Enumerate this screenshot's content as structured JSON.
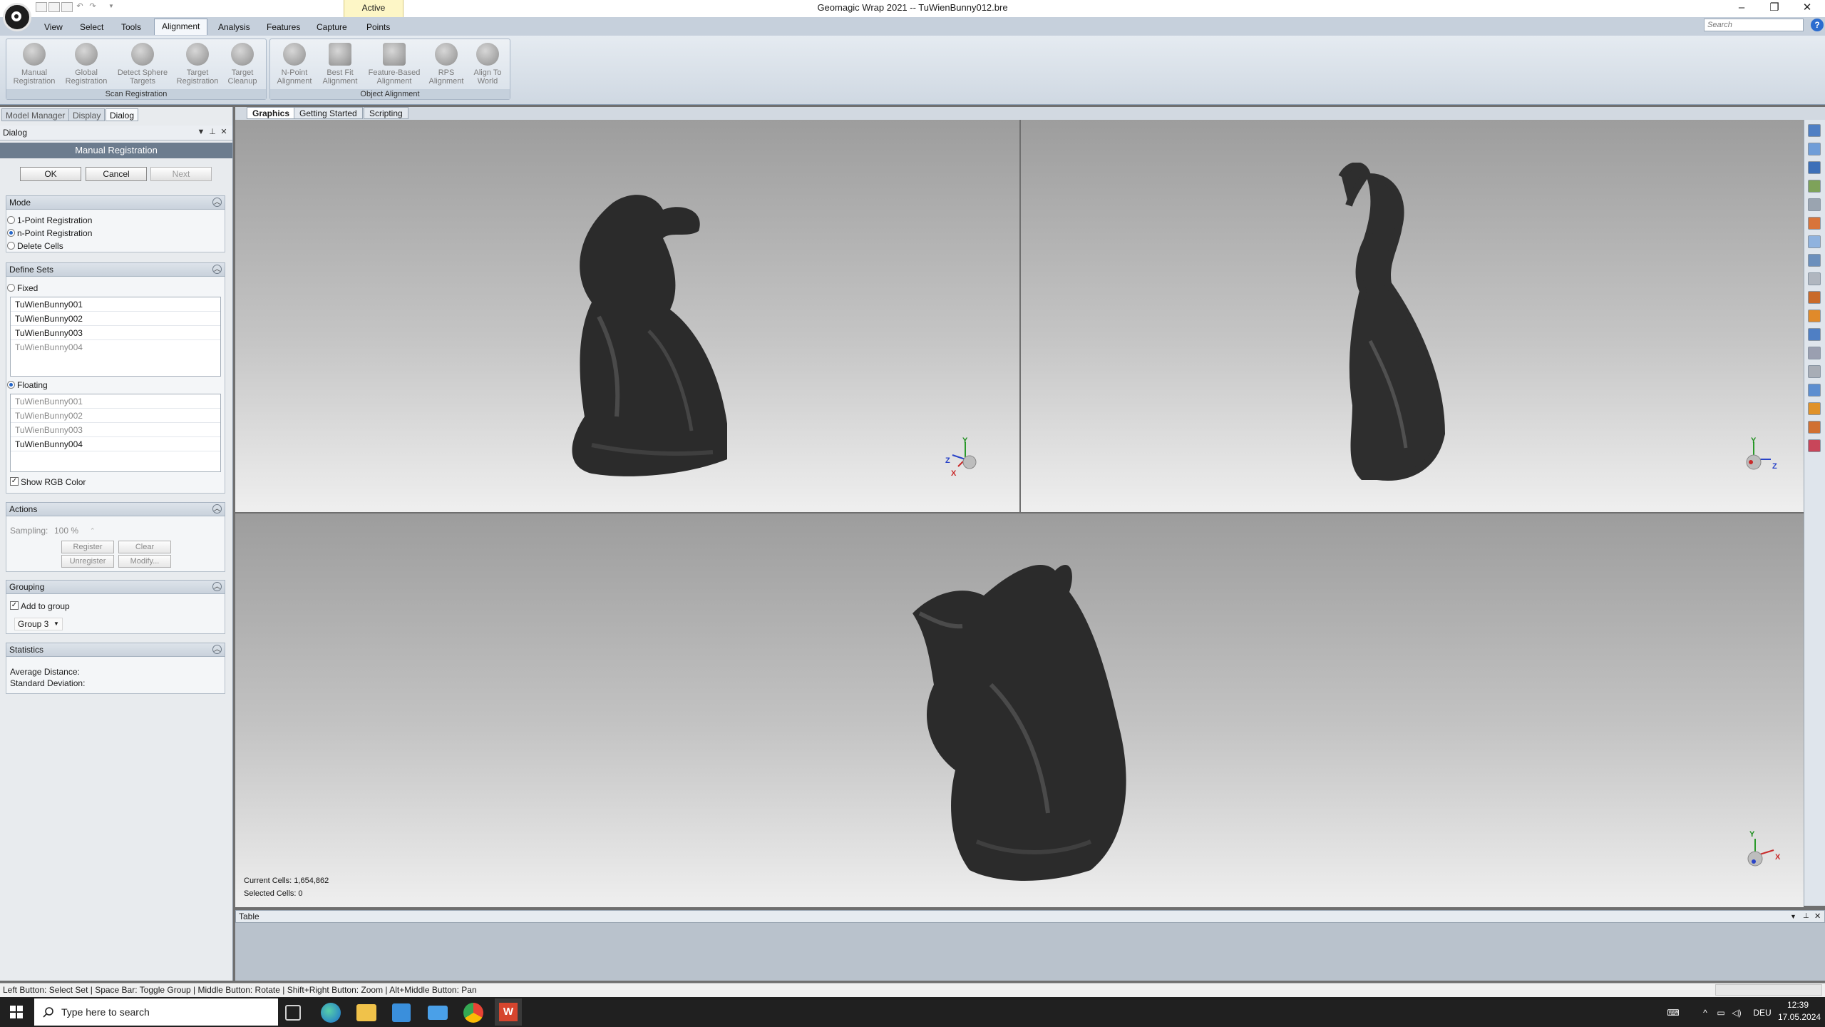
{
  "window": {
    "title": "Geomagic Wrap 2021 -- TuWienBunny012.bre",
    "active_label": "Active",
    "minimize": "–",
    "restore": "❐",
    "close": "✕"
  },
  "ribbon_tabs": [
    "View",
    "Select",
    "Tools",
    "Alignment",
    "Analysis",
    "Features",
    "Capture",
    "Points"
  ],
  "active_tab": "Alignment",
  "search_placeholder": "Search",
  "help_label": "?",
  "ribbon_groups": {
    "scan_registration": {
      "label": "Scan Registration",
      "buttons": [
        "Manual\nRegistration",
        "Global\nRegistration",
        "Detect Sphere\nTargets",
        "Target\nRegistration",
        "Target\nCleanup"
      ]
    },
    "object_alignment": {
      "label": "Object Alignment",
      "buttons": [
        "N-Point\nAlignment",
        "Best Fit\nAlignment",
        "Feature-Based\nAlignment",
        "RPS\nAlignment",
        "Align To\nWorld"
      ]
    }
  },
  "panel_tabs": [
    "Model Manager",
    "Display",
    "Dialog"
  ],
  "active_panel_tab": "Dialog",
  "dialog": {
    "header": "Dialog",
    "title": "Manual Registration",
    "ok": "OK",
    "cancel": "Cancel",
    "next": "Next",
    "mode": {
      "label": "Mode",
      "options": [
        "1-Point Registration",
        "n-Point Registration",
        "Delete Cells"
      ],
      "selected": 1
    },
    "define_sets": {
      "label": "Define Sets",
      "fixed_label": "Fixed",
      "fixed_items": [
        "TuWienBunny001",
        "TuWienBunny002",
        "TuWienBunny003",
        "TuWienBunny004"
      ],
      "floating_label": "Floating",
      "floating_items": [
        "TuWienBunny001",
        "TuWienBunny002",
        "TuWienBunny003",
        "TuWienBunny004"
      ],
      "show_rgb": "Show RGB Color"
    },
    "actions": {
      "label": "Actions",
      "sampling_label": "Sampling:",
      "sampling_value": "100 %",
      "register": "Register",
      "clear": "Clear",
      "unregister": "Unregister",
      "modify": "Modify..."
    },
    "grouping": {
      "label": "Grouping",
      "add_to_group": "Add to group",
      "group_value": "Group 3"
    },
    "statistics": {
      "label": "Statistics",
      "avg": "Average Distance:",
      "std": "Standard Deviation:"
    }
  },
  "view_tabs": [
    "Graphics",
    "Getting Started",
    "Scripting"
  ],
  "active_view_tab": "Graphics",
  "viewport": {
    "current_cells": "Current Cells: 1,654,862",
    "selected_cells": "Selected Cells: 0",
    "axes": {
      "x": "X",
      "y": "Y",
      "z": "Z"
    }
  },
  "table_label": "Table",
  "status_text": "Left Button: Select Set | Space Bar: Toggle Group | Middle Button: Rotate | Shift+Right Button: Zoom | Alt+Middle Button: Pan",
  "taskbar": {
    "search_placeholder": "Type here to search",
    "language": "DEU",
    "time": "12:39",
    "date": "17.05.2024"
  }
}
